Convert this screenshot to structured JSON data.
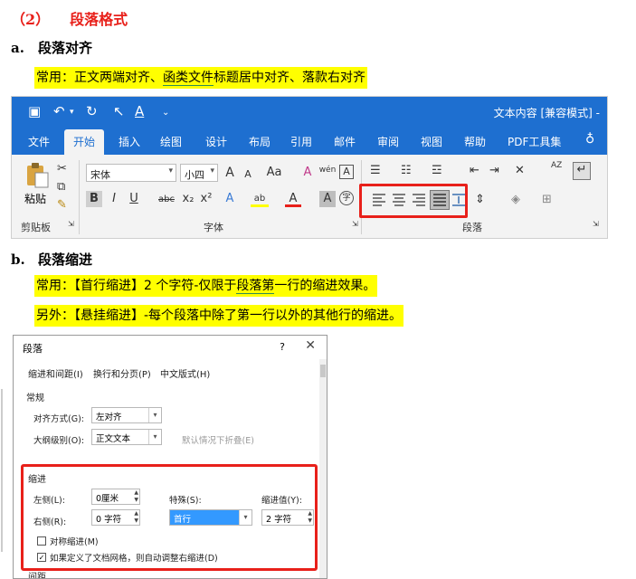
{
  "heading": {
    "number": "（2）",
    "title": "段落格式"
  },
  "section_a": {
    "letter": "a.",
    "title": "段落对齐",
    "note_prefix": "常用：正文两端对齐、",
    "note_underlined": "函类文件",
    "note_suffix": "标题居中对齐、落款右对齐"
  },
  "ribbon": {
    "doc_title": "文本内容 [兼容模式] -",
    "tabs": [
      "文件",
      "开始",
      "插入",
      "绘图",
      "设计",
      "布局",
      "引用",
      "邮件",
      "审阅",
      "视图",
      "帮助",
      "PDF工具集"
    ],
    "active_tab": "开始",
    "paste_label": "粘贴",
    "clipboard_label": "剪贴板",
    "font_label": "字体",
    "paragraph_label": "段落",
    "font_name": "宋体",
    "font_size": "小四",
    "bold": "B",
    "italic": "I",
    "underline": "U",
    "strike": "abc",
    "subscript": "x₂",
    "superscript": "x²",
    "grow_font": "A",
    "shrink_font": "A",
    "change_case": "Aa",
    "clear_format": "A",
    "phonetic": "wén",
    "char_border": "A",
    "text_effect": "A",
    "highlight": "ab",
    "font_color": "A",
    "char_shading": "A",
    "enclose": "字",
    "sort": "AZ",
    "colors": {
      "accent": "#1e6fd0",
      "highlight": "#ffff00",
      "font_color": "#e8201a",
      "red_box": "#e8201a"
    }
  },
  "section_b": {
    "letter": "b.",
    "title": "段落缩进",
    "note1_prefix": "常用：【首行缩进】2 个字符-仅限于",
    "note1_underlined": "段落第",
    "note1_suffix": "一行的缩进效果。",
    "note2": "另外：【悬挂缩进】-每个段落中除了第一行以外的其他行的缩进。"
  },
  "dialog": {
    "title": "段落",
    "help": "?",
    "close": "✕",
    "tabs": [
      "缩进和间距(I)",
      "换行和分页(P)",
      "中文版式(H)"
    ],
    "general_section": "常规",
    "alignment_label": "对齐方式(G):",
    "alignment_value": "左对齐",
    "outline_label": "大纲级别(O):",
    "outline_value": "正文文本",
    "collapsed_label": "默认情况下折叠(E)",
    "indent_section": "缩进",
    "left_label": "左侧(L):",
    "left_value": "0厘米",
    "right_label": "右侧(R):",
    "right_value": "0 字符",
    "special_label": "特殊(S):",
    "special_value": "首行",
    "indent_by_label": "缩进值(Y):",
    "indent_by_value": "2 字符",
    "mirror_label": "对称缩进(M)",
    "auto_adjust_label": "如果定义了文档网格，则自动调整右缩进(D)",
    "spacing_section": "间距"
  }
}
